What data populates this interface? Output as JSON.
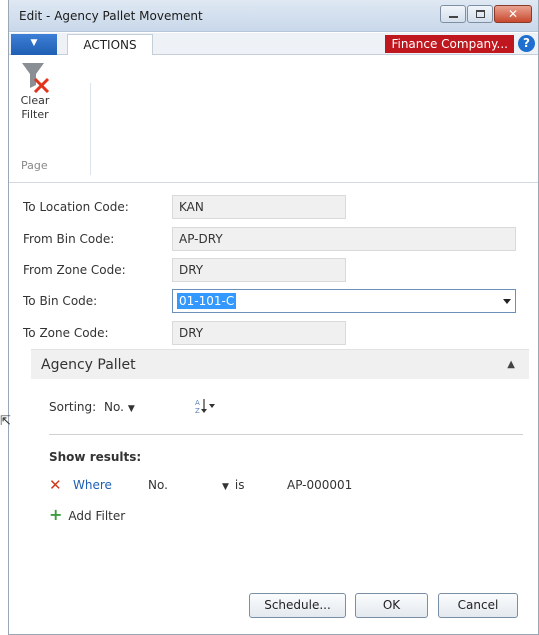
{
  "window": {
    "title": "Edit - Agency Pallet Movement",
    "minimize_glyph": "–",
    "maximize_glyph": "□",
    "close_glyph": "✕"
  },
  "ribbon": {
    "app_menu_glyph": "▼",
    "tab_actions": "ACTIONS",
    "company": "Finance Company...",
    "help_glyph": "?",
    "clear_filter_label_line1": "Clear",
    "clear_filter_label_line2": "Filter",
    "group_label": "Page"
  },
  "fields": [
    {
      "label": "To Location Code:",
      "value": "KAN"
    },
    {
      "label": "From Bin Code:",
      "value": "AP-DRY"
    },
    {
      "label": "From Zone Code:",
      "value": "DRY"
    },
    {
      "label": "To Bin Code:",
      "value": "01-101-C"
    },
    {
      "label": "To Zone Code:",
      "value": "DRY"
    }
  ],
  "section": {
    "title": "Agency Pallet",
    "caret": "▲"
  },
  "sorting": {
    "label": "Sorting:",
    "field": "No.",
    "caret": "▼",
    "order_icon_text": "A↓Z"
  },
  "filters": {
    "show_results": "Show results:",
    "remove_glyph": "✕",
    "row": {
      "where": "Where",
      "field": "No.",
      "operator": "is",
      "value": "AP-000001"
    },
    "add_glyph": "+",
    "add_filter": "Add Filter"
  },
  "buttons": {
    "schedule": "Schedule...",
    "ok": "OK",
    "cancel": "Cancel"
  }
}
